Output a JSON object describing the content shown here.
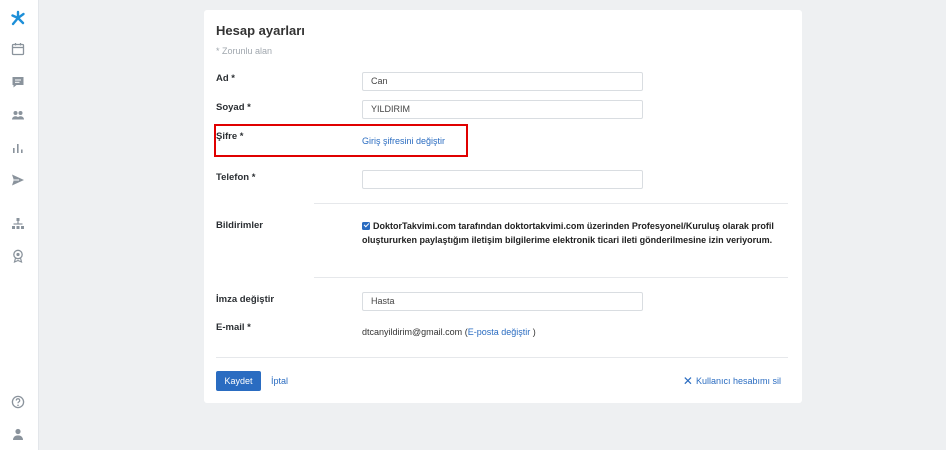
{
  "sidebar": {
    "icons": [
      "logo-icon",
      "calendar-icon",
      "chat-icon",
      "patients-icon",
      "stats-icon",
      "send-icon",
      "hierarchy-icon",
      "badge-icon",
      "help-icon",
      "user-icon"
    ]
  },
  "form": {
    "title": "Hesap ayarları",
    "required_note": "* Zorunlu alan",
    "first_name": {
      "label": "Ad *",
      "value": "Can"
    },
    "last_name": {
      "label": "Soyad *",
      "value": "YILDIRIM"
    },
    "password": {
      "label": "Şifre *",
      "link": "Giriş şifresini değiştir"
    },
    "phone": {
      "label": "Telefon *",
      "value": ""
    },
    "notifications": {
      "label": "Bildirimler",
      "text": "DoktorTakvimi.com tarafından doktortakvimi.com üzerinden Profesyonel/Kuruluş olarak profil oluştururken paylaştığım iletişim bilgilerime elektronik ticari ileti gönderilmesine izin veriyorum."
    },
    "signature": {
      "label": "İmza değiştir",
      "value": "Hasta"
    },
    "email": {
      "label": "E-mail *",
      "value": "dtcanyildirim@gmail.com",
      "open": "(",
      "link": "E-posta değiştir",
      "close": ")"
    }
  },
  "actions": {
    "save": "Kaydet",
    "cancel": "İptal",
    "delete_account": "Kullanıcı hesabımı sil"
  },
  "colors": {
    "accent": "#2a6cc1",
    "highlight": "#e00000"
  }
}
